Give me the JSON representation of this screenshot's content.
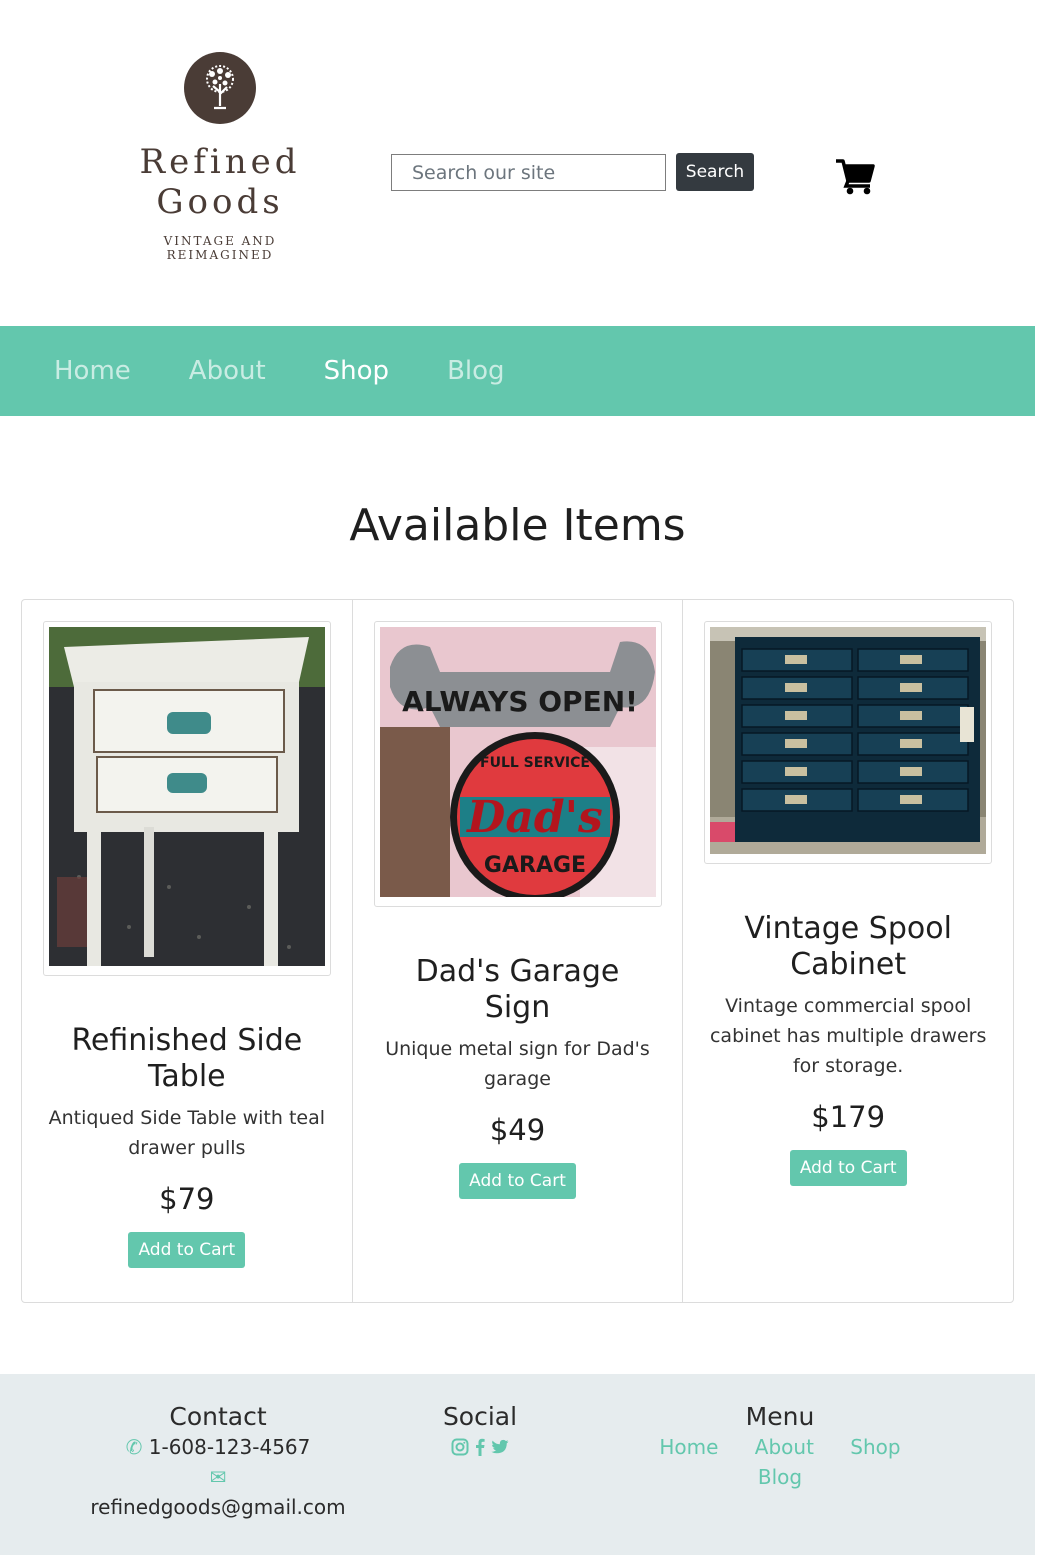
{
  "header": {
    "logo": {
      "name_line1": "Refined",
      "name_line2": "Goods",
      "tagline_line1": "VINTAGE AND",
      "tagline_line2": "REIMAGINED"
    },
    "search": {
      "placeholder": "Search our site",
      "button_label": "Search"
    },
    "cart_icon": "shopping-cart-icon"
  },
  "nav": {
    "items": [
      {
        "label": "Home",
        "active": false
      },
      {
        "label": "About",
        "active": false
      },
      {
        "label": "Shop",
        "active": true
      },
      {
        "label": "Blog",
        "active": false
      }
    ]
  },
  "main": {
    "title": "Available Items",
    "products": [
      {
        "name": "Refinished Side Table",
        "description": "Antiqued Side Table with teal drawer pulls",
        "price": "$79",
        "button_label": "Add to Cart"
      },
      {
        "name": "Dad's Garage Sign",
        "description": "Unique metal sign for Dad's garage",
        "price": "$49",
        "button_label": "Add to Cart"
      },
      {
        "name": "Vintage Spool Cabinet",
        "description": "Vintage commercial spool cabinet has multiple drawers for storage.",
        "price": "$179",
        "button_label": "Add to Cart"
      }
    ]
  },
  "footer": {
    "contact": {
      "heading": "Contact",
      "phone": "1-608-123-4567",
      "email": "refinedgoods@gmail.com"
    },
    "social": {
      "heading": "Social",
      "icons": [
        "instagram-icon",
        "facebook-icon",
        "twitter-icon"
      ]
    },
    "menu": {
      "heading": "Menu",
      "items": [
        "Home",
        "About",
        "Shop",
        "Blog"
      ]
    }
  },
  "colors": {
    "accent": "#63c7ad",
    "dark_button": "#343a40",
    "footer_bg": "#e6ecee",
    "logo_brown": "#4a3c36"
  }
}
